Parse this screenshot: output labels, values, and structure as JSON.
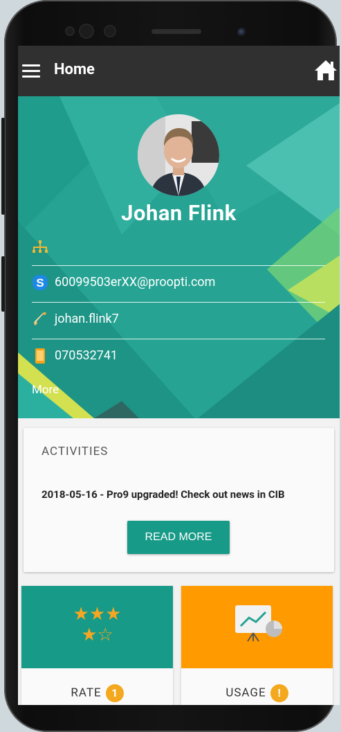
{
  "appbar": {
    "title": "Home"
  },
  "profile": {
    "name": "Johan Flink",
    "skype": "60099503erXX@proopti.com",
    "phone": "johan.flink7",
    "mobile": "070532741",
    "more_label": "More"
  },
  "activities": {
    "title": "ACTIVITIES",
    "text": "2018-05-16 - Pro9 upgraded! Check out news in CIB",
    "button_label": "READ MORE"
  },
  "tiles": {
    "rate": {
      "label": "RATE",
      "badge": "1",
      "color": "#179a87",
      "stars_row1": "★★★",
      "stars_row2": "★☆"
    },
    "usage": {
      "label": "USAGE",
      "badge": "!",
      "color": "#ff9b00"
    }
  },
  "colors": {
    "appbar": "#303030",
    "teal": "#25a396",
    "accent": "#179a87",
    "orange": "#ff9b00",
    "badge": "#f4a81d"
  }
}
